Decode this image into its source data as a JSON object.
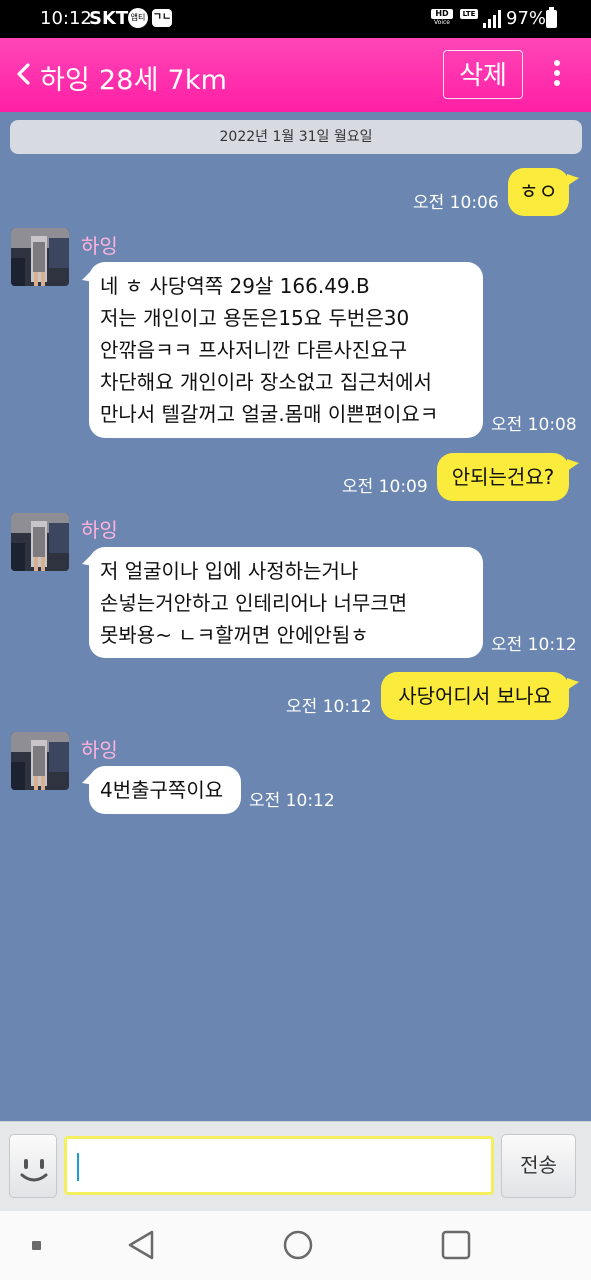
{
  "status_bar": {
    "time": "10:12",
    "carrier": "SKT",
    "badge_circle": "앱티",
    "badge_square": "ㄱㄴ",
    "hd_label": "HD",
    "voice_label": "Voice",
    "lte_label": "LTE",
    "battery": "97%"
  },
  "header": {
    "title": "하잉 28세 7km",
    "delete_label": "삭제",
    "accent_color": "#ff2aa8"
  },
  "chat": {
    "date_banner": "2022년 1월 31일 월요일",
    "sender_name": "하잉",
    "messages": [
      {
        "direction": "out",
        "text": "ㅎㅇ",
        "time": "오전 10:06"
      },
      {
        "direction": "in",
        "lines": [
          "네 ㅎ 사당역쪽 29살 166.49.B",
          "저는 개인이고 용돈은15요 두번은30",
          "안깎음ㅋㅋ 프사저니깐 다른사진요구",
          "차단해요 개인이라 장소없고 집근처에서",
          "만나서 텔갈꺼고 얼굴.몸매 이쁜편이요ㅋ"
        ],
        "time": "오전 10:08"
      },
      {
        "direction": "out",
        "text": "안되는건요?",
        "time": "오전 10:09"
      },
      {
        "direction": "in",
        "lines": [
          "저 얼굴이나 입에 사정하는거나",
          "손넣는거안하고 인테리어나 너무크면",
          "못봐용~ ㄴㅋ할꺼면 안에안됨ㅎ"
        ],
        "time": "오전 10:12"
      },
      {
        "direction": "out",
        "text": "사당어디서 보나요",
        "time": "오전 10:12"
      },
      {
        "direction": "in",
        "lines": [
          "4번출구쪽이요"
        ],
        "time": "오전 10:12"
      }
    ]
  },
  "input_bar": {
    "placeholder": "",
    "send_label": "전송"
  }
}
